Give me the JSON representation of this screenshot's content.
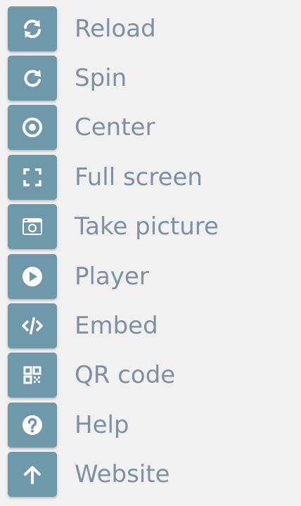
{
  "menu": {
    "items": [
      {
        "label": "Reload",
        "icon": "refresh-icon"
      },
      {
        "label": "Spin",
        "icon": "rotate-icon"
      },
      {
        "label": "Center",
        "icon": "target-icon"
      },
      {
        "label": "Full screen",
        "icon": "fullscreen-icon"
      },
      {
        "label": "Take picture",
        "icon": "camera-icon"
      },
      {
        "label": "Player",
        "icon": "play-icon"
      },
      {
        "label": "Embed",
        "icon": "code-icon"
      },
      {
        "label": "QR code",
        "icon": "qrcode-icon"
      },
      {
        "label": "Help",
        "icon": "help-icon"
      },
      {
        "label": "Website",
        "icon": "arrow-up-icon"
      }
    ]
  },
  "colors": {
    "background": "#f1f1f1",
    "button": "#6f98aa",
    "icon": "#ffffff",
    "label": "#7f90a2"
  }
}
